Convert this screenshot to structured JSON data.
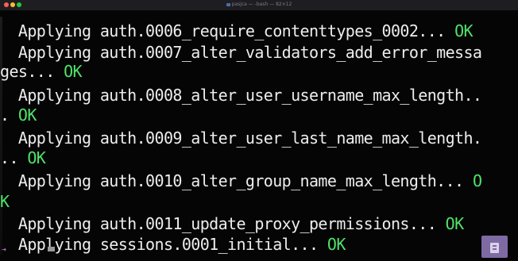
{
  "window": {
    "title": "pasjca — -bash — 82×12"
  },
  "terminal": {
    "lines": [
      {
        "text": "  Applying auth.0006_require_contenttypes_0002... ",
        "status": "OK"
      },
      {
        "text": "  Applying auth.0007_alter_validators_add_error_messa",
        "status": ""
      },
      {
        "text": "ges... ",
        "status": "OK"
      },
      {
        "text": "  Applying auth.0008_alter_user_username_max_length..",
        "status": ""
      },
      {
        "text": ". ",
        "status": "OK"
      },
      {
        "text": "  Applying auth.0009_alter_user_last_name_max_length.",
        "status": ""
      },
      {
        "text": ".. ",
        "status": "OK"
      },
      {
        "text": "  Applying auth.0010_alter_group_name_max_length... ",
        "status": "O"
      },
      {
        "text": "",
        "status": "K"
      },
      {
        "text": "  Applying auth.0011_update_proxy_permissions... ",
        "status": "OK"
      },
      {
        "text": "  Applying sessions.0001_initial... ",
        "status": "OK"
      }
    ]
  },
  "colors": {
    "background": "#050505",
    "text": "#ededed",
    "ok": "#4fe26a"
  }
}
